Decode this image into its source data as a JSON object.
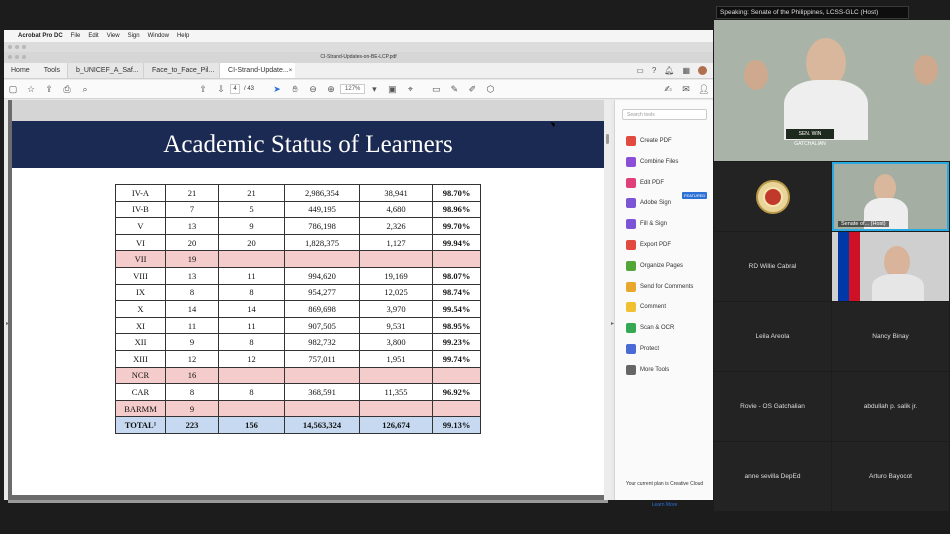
{
  "menubar": {
    "app": "Acrobat Pro DC",
    "items": [
      "File",
      "Edit",
      "View",
      "Sign",
      "Window",
      "Help"
    ]
  },
  "window_title": "CI-Strand-Updates-on-BE-LCP.pdf",
  "tabs": {
    "home": "Home",
    "tools": "Tools",
    "docs": [
      {
        "label": "b_UNICEF_A_Saf..."
      },
      {
        "label": "Face_to_Face_Pil..."
      },
      {
        "label": "CI-Strand-Update...",
        "close": "×"
      }
    ]
  },
  "toolbar": {
    "page_current": "4",
    "page_total": "/ 43",
    "zoom": "127%"
  },
  "slide": {
    "title": "Academic Status of Learners",
    "rows": [
      {
        "region": "IV-A",
        "a": "21",
        "b": "21",
        "c": "2,986,354",
        "d": "38,941",
        "pct": "98.70%",
        "pink": false
      },
      {
        "region": "IV-B",
        "a": "7",
        "b": "5",
        "c": "449,195",
        "d": "4,680",
        "pct": "98.96%",
        "pink": false
      },
      {
        "region": "V",
        "a": "13",
        "b": "9",
        "c": "786,198",
        "d": "2,326",
        "pct": "99.70%",
        "pink": false
      },
      {
        "region": "VI",
        "a": "20",
        "b": "20",
        "c": "1,828,375",
        "d": "1,127",
        "pct": "99.94%",
        "pink": false
      },
      {
        "region": "VII",
        "a": "19",
        "b": "",
        "c": "",
        "d": "",
        "pct": "",
        "pink": true
      },
      {
        "region": "VIII",
        "a": "13",
        "b": "11",
        "c": "994,620",
        "d": "19,169",
        "pct": "98.07%",
        "pink": false
      },
      {
        "region": "IX",
        "a": "8",
        "b": "8",
        "c": "954,277",
        "d": "12,025",
        "pct": "98.74%",
        "pink": false
      },
      {
        "region": "X",
        "a": "14",
        "b": "14",
        "c": "869,698",
        "d": "3,970",
        "pct": "99.54%",
        "pink": false
      },
      {
        "region": "XI",
        "a": "11",
        "b": "11",
        "c": "907,505",
        "d": "9,531",
        "pct": "98.95%",
        "pink": false
      },
      {
        "region": "XII",
        "a": "9",
        "b": "8",
        "c": "982,732",
        "d": "3,800",
        "pct": "99.23%",
        "pink": false
      },
      {
        "region": "XIII",
        "a": "12",
        "b": "12",
        "c": "757,011",
        "d": "1,951",
        "pct": "99.74%",
        "pink": false
      },
      {
        "region": "NCR",
        "a": "16",
        "b": "",
        "c": "",
        "d": "",
        "pct": "",
        "pink": true
      },
      {
        "region": "CAR",
        "a": "8",
        "b": "8",
        "c": "368,591",
        "d": "11,355",
        "pct": "96.92%",
        "pink": false
      },
      {
        "region": "BARMM",
        "a": "9",
        "b": "",
        "c": "",
        "d": "",
        "pct": "",
        "pink": true
      }
    ],
    "total": {
      "region": "TOTAL¹",
      "a": "223",
      "b": "156",
      "c": "14,563,324",
      "d": "126,674",
      "pct": "99.13%"
    }
  },
  "tools_pane": {
    "search_placeholder": "Search tools",
    "items": [
      {
        "label": "Create PDF",
        "color": "#e04a3f"
      },
      {
        "label": "Combine Files",
        "color": "#8a4fd6"
      },
      {
        "label": "Edit PDF",
        "color": "#e0407a"
      },
      {
        "label": "Adobe Sign",
        "color": "#7b55d6"
      },
      {
        "label": "Fill & Sign",
        "color": "#7b55d6"
      },
      {
        "label": "Export PDF",
        "color": "#e04a3f"
      },
      {
        "label": "Organize Pages",
        "color": "#52a638"
      },
      {
        "label": "Send for Comments",
        "color": "#e8a82c"
      },
      {
        "label": "Comment",
        "color": "#f0c030"
      },
      {
        "label": "Scan & OCR",
        "color": "#35a853"
      },
      {
        "label": "Protect",
        "color": "#4a6ad6"
      },
      {
        "label": "More Tools",
        "color": "#666666"
      }
    ],
    "featured_badge": "FEATURED",
    "plan_text": "Your current plan is Creative Cloud",
    "learn_more": "Learn More"
  },
  "zoom": {
    "speaking": "Speaking: Senate of the Philippines, LCSS-GLC (Host)",
    "nameplate": "SEN. WIN GATCHALIAN",
    "host_label": "Senate of... (Host)",
    "participants": [
      "RD Willie Cabral",
      "Leila Areola",
      "Nancy Binay",
      "Rovie - OS Gatchalian",
      "abdullah p. salik jr.",
      "anne sevilla DepEd",
      "Arturo Bayocot"
    ]
  }
}
